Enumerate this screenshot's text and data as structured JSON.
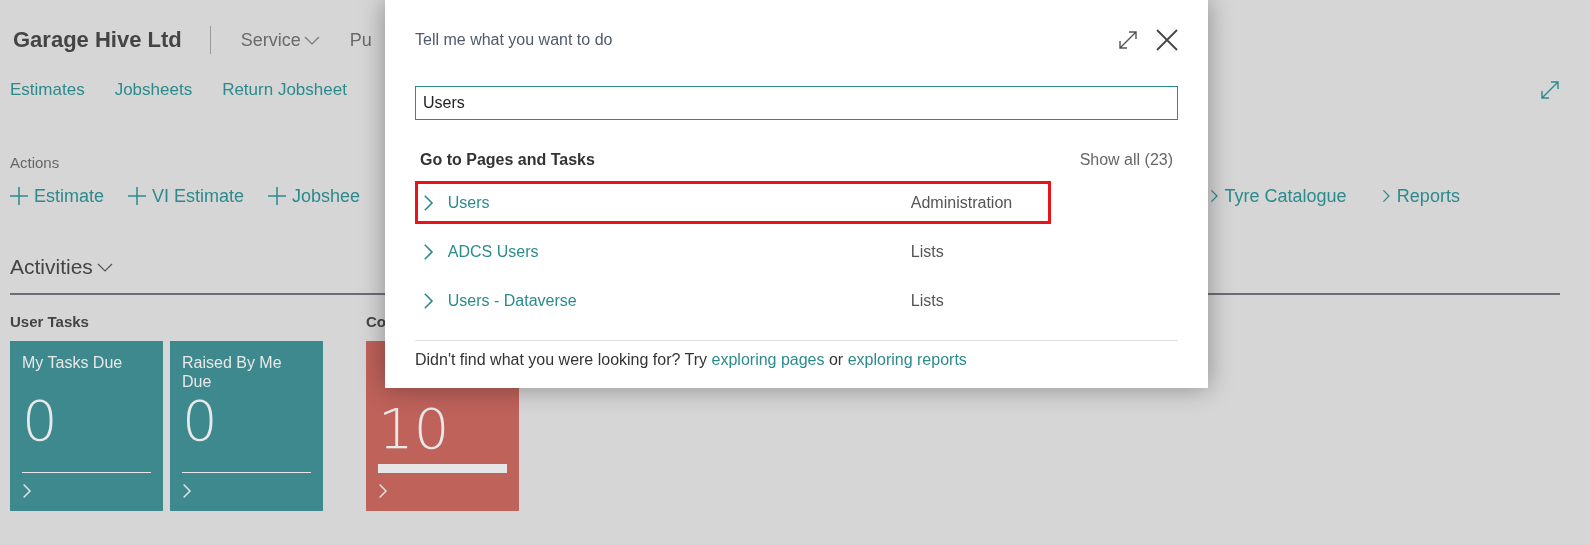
{
  "header": {
    "company": "Garage Hive Ltd",
    "menus": [
      {
        "label": "Service",
        "dropdown": true
      },
      {
        "label": "Pu",
        "dropdown": false
      }
    ]
  },
  "nav_links": [
    "Estimates",
    "Jobsheets",
    "Return Jobsheet"
  ],
  "actions": {
    "label": "Actions",
    "items": [
      {
        "label": "Estimate",
        "kind": "new"
      },
      {
        "label": "VI Estimate",
        "kind": "new"
      },
      {
        "label": "Jobshee",
        "kind": "new"
      },
      {
        "label": "Tyre Catalogue",
        "kind": "group"
      },
      {
        "label": "Reports",
        "kind": "group"
      }
    ]
  },
  "activities": {
    "title": "Activities",
    "expanded": true,
    "groups": [
      {
        "label": "User Tasks",
        "tiles": [
          {
            "title": "My Tasks Due",
            "value": "0",
            "kind": "normal"
          },
          {
            "title": "Raised By Me Due",
            "value": "0",
            "kind": "normal"
          }
        ]
      },
      {
        "label": "Co",
        "tiles": [
          {
            "value": "10",
            "kind": "alert"
          }
        ]
      }
    ]
  },
  "dialog": {
    "title": "Tell me what you want to do",
    "search": {
      "value": "Users"
    },
    "section_title": "Go to Pages and Tasks",
    "show_all": "Show all (23)",
    "results": [
      {
        "name": "Users",
        "category": "Administration",
        "highlighted": true
      },
      {
        "name": "ADCS Users",
        "category": "Lists",
        "highlighted": false
      },
      {
        "name": "Users - Dataverse",
        "category": "Lists",
        "highlighted": false
      }
    ],
    "footer": {
      "text": "Didn't find what you were looking for? Try",
      "link1": "exploring pages",
      "joiner": "or",
      "link2": "exploring reports"
    }
  }
}
